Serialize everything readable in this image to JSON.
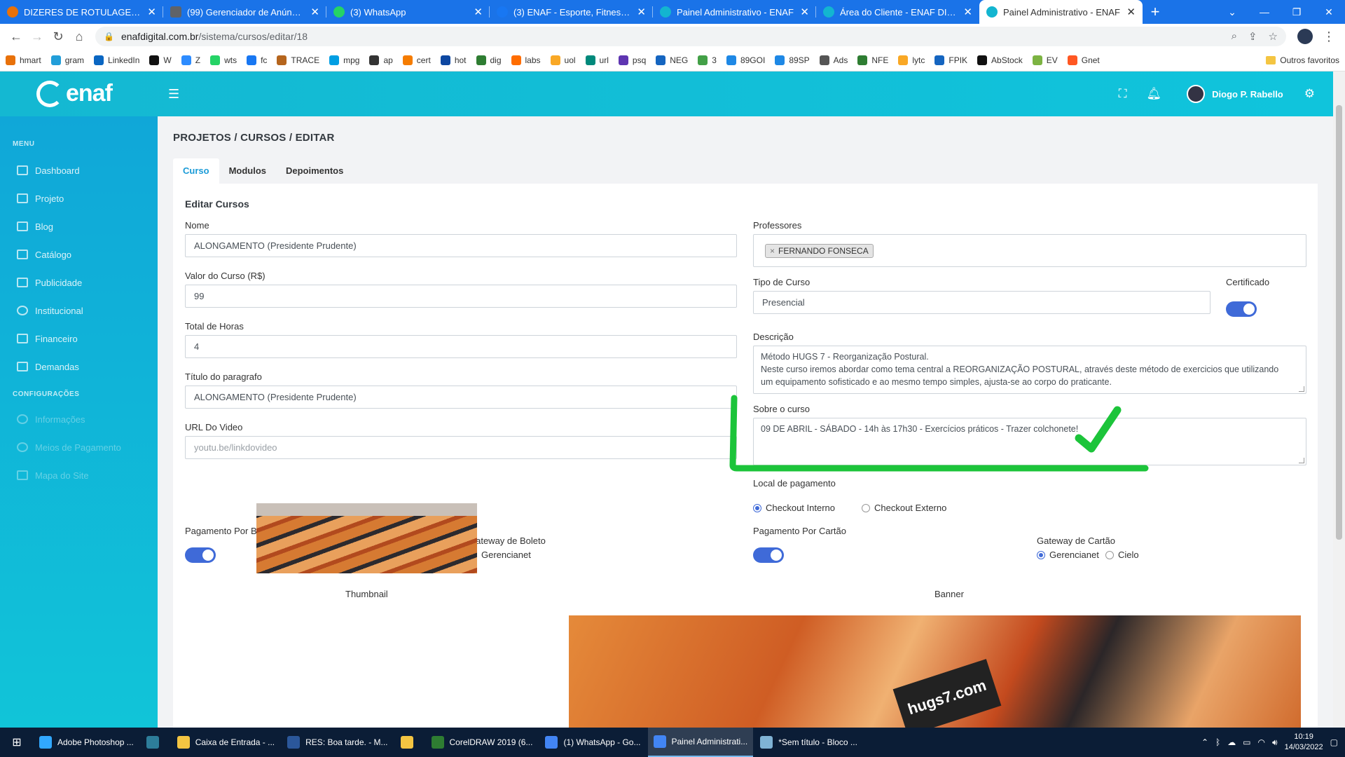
{
  "browser": {
    "tabs": [
      {
        "title": "DIZERES DE ROTULAGEM OXI P",
        "color": "#e8710a"
      },
      {
        "title": "(99) Gerenciador de Anúncios -",
        "color": "#5f6368"
      },
      {
        "title": "(3) WhatsApp",
        "color": "#25d366"
      },
      {
        "title": "(3) ENAF - Esporte, Fitness e Sa",
        "color": "#1877f2"
      },
      {
        "title": "Painel Administrativo - ENAF",
        "color": "#13b5d0"
      },
      {
        "title": "Área do Cliente - ENAF DIGITAL",
        "color": "#13b5d0"
      },
      {
        "title": "Painel Administrativo - ENAF",
        "color": "#13b5d0"
      }
    ],
    "url_host": "enafdigital.com.br",
    "url_path": "/sistema/cursos/editar/18",
    "bookmarks": [
      {
        "label": "hmart",
        "color": "#e8710a"
      },
      {
        "label": "gram",
        "color": "#229ed9"
      },
      {
        "label": "LinkedIn",
        "color": "#0a66c2"
      },
      {
        "label": "W",
        "color": "#111"
      },
      {
        "label": "Z",
        "color": "#2d8cff"
      },
      {
        "label": "wts",
        "color": "#25d366"
      },
      {
        "label": "fc",
        "color": "#1877f2"
      },
      {
        "label": "TRACE",
        "color": "#b5651d"
      },
      {
        "label": "mpg",
        "color": "#009ee3"
      },
      {
        "label": "ap",
        "color": "#333"
      },
      {
        "label": "cert",
        "color": "#f57c00"
      },
      {
        "label": "hot",
        "color": "#0d47a1"
      },
      {
        "label": "dig",
        "color": "#2e7d32"
      },
      {
        "label": "labs",
        "color": "#ff6d00"
      },
      {
        "label": "uol",
        "color": "#f9a825"
      },
      {
        "label": "url",
        "color": "#00897b"
      },
      {
        "label": "psq",
        "color": "#5e35b1"
      },
      {
        "label": "NEG",
        "color": "#1565c0"
      },
      {
        "label": "3",
        "color": "#43a047"
      },
      {
        "label": "89GOI",
        "color": "#1e88e5"
      },
      {
        "label": "89SP",
        "color": "#1e88e5"
      },
      {
        "label": "Ads",
        "color": "#555"
      },
      {
        "label": "NFE",
        "color": "#2e7d32"
      },
      {
        "label": "lytc",
        "color": "#f9a825"
      },
      {
        "label": "FPIK",
        "color": "#1565c0"
      },
      {
        "label": "AbStock",
        "color": "#111"
      },
      {
        "label": "EV",
        "color": "#7cb342"
      },
      {
        "label": "Gnet",
        "color": "#ff5722"
      }
    ],
    "other_bookmarks": "Outros favoritos"
  },
  "app": {
    "logo_text": "enaf",
    "user_name": "Diogo P. Rabello"
  },
  "sidebar": {
    "menu_heading": "MENU",
    "items": [
      "Dashboard",
      "Projeto",
      "Blog",
      "Catálogo",
      "Publicidade",
      "Institucional",
      "Financeiro",
      "Demandas"
    ],
    "config_heading": "CONFIGURAÇÕES",
    "config_items": [
      "Informações",
      "Meios de Pagamento",
      "Mapa do Site"
    ]
  },
  "page": {
    "breadcrumb": "PROJETOS / CURSOS / EDITAR",
    "tabs": [
      "Curso",
      "Modulos",
      "Depoimentos"
    ],
    "section_title": "Editar Cursos"
  },
  "form": {
    "nome_label": "Nome",
    "nome_value": "ALONGAMENTO (Presidente Prudente)",
    "valor_label": "Valor do Curso (R$)",
    "valor_value": "99",
    "horas_label": "Total de Horas",
    "horas_value": "4",
    "titulo_label": "Título do paragrafo",
    "titulo_value": "ALONGAMENTO (Presidente Prudente)",
    "video_label": "URL Do Video",
    "video_placeholder": "youtu.be/linkdovideo",
    "professores_label": "Professores",
    "professor_chip": "FERNANDO FONSECA",
    "tipo_label": "Tipo de Curso",
    "tipo_value": "Presencial",
    "certificado_label": "Certificado",
    "descricao_label": "Descrição",
    "descricao_line1": "Método HUGS 7 - Reorganização Postural.",
    "descricao_line2": "Neste curso iremos abordar como tema central a REORGANIZAÇÃO POSTURAL, através deste método de exercicios que utilizando",
    "descricao_line3": "um equipamento sofisticado e ao mesmo tempo simples, ajusta-se ao corpo do praticante.",
    "sobre_label": "Sobre o curso",
    "sobre_value": "09 DE ABRIL - SÁBADO - 14h às 17h30 - Exercícios práticos - Trazer colchonete!",
    "local_label": "Local de pagamento",
    "local_options": [
      "Checkout Interno",
      "Checkout Externo"
    ],
    "boleto_label": "Pagamento Por Boleto",
    "gateway_boleto_label": "Gateway de Boleto",
    "gateway_boleto_option": "Gerencianet",
    "cartao_label": "Pagamento Por Cartão",
    "gateway_cartao_label": "Gateway de Cartão",
    "gateway_cartao_options": [
      "Gerencianet",
      "Cielo"
    ],
    "thumbnail_label": "Thumbnail",
    "banner_label": "Banner",
    "banner_plate_text": "hugs7.com"
  },
  "taskbar": {
    "items": [
      {
        "label": "Adobe Photoshop ...",
        "color": "#31a8ff"
      },
      {
        "label": "",
        "color": "#2d7d9a"
      },
      {
        "label": "Caixa de Entrada - ...",
        "color": "#f4c542"
      },
      {
        "label": "RES: Boa tarde. - M...",
        "color": "#2b579a"
      },
      {
        "label": "",
        "color": "#f4c542"
      },
      {
        "label": "CorelDRAW 2019 (6...",
        "color": "#2e7d32"
      },
      {
        "label": "(1) WhatsApp - Go...",
        "color": "#4285f4"
      },
      {
        "label": "Painel Administrati...",
        "color": "#4285f4"
      },
      {
        "label": "*Sem título - Bloco ...",
        "color": "#7fb3d5"
      }
    ],
    "time": "10:19",
    "date": "14/03/2022"
  }
}
